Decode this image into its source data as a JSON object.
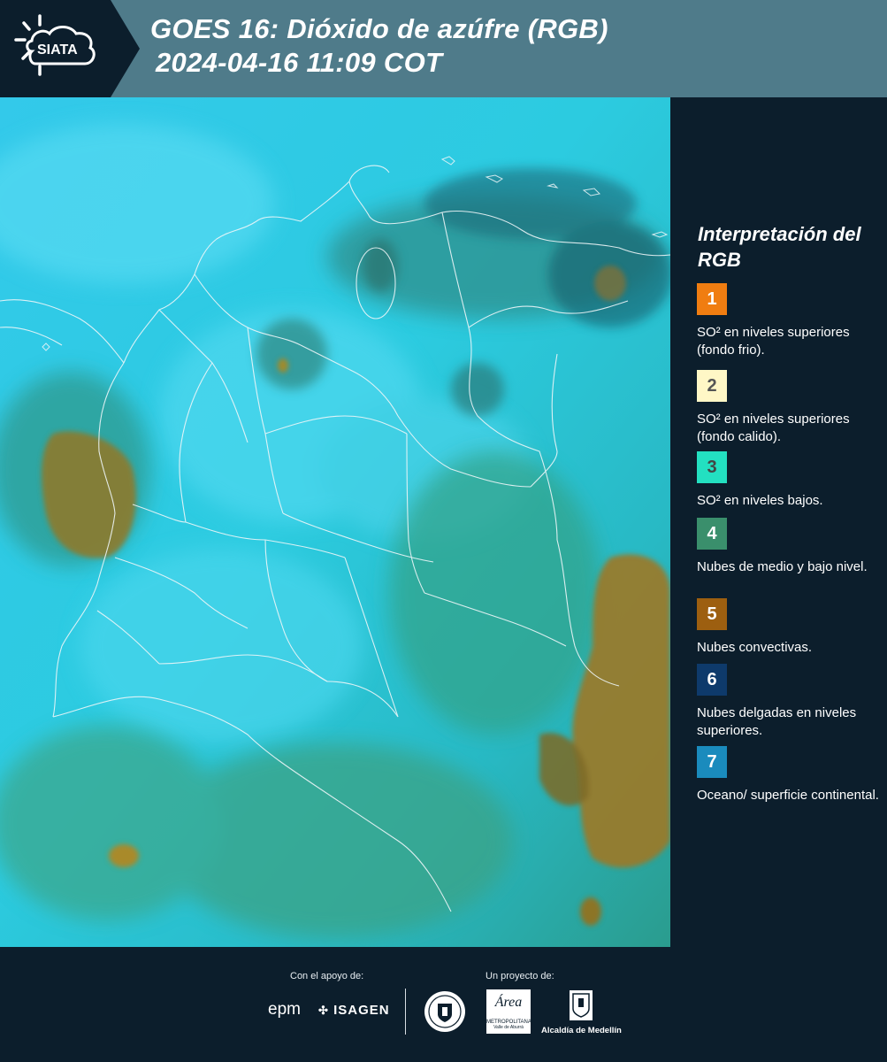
{
  "header": {
    "logo_text": "SIATA",
    "title_line1": "GOES 16: Dióxido de azúfre (RGB)",
    "title_line2": "2024-04-16 11:09 COT",
    "bg_color": "#4f7b8a"
  },
  "legend": {
    "title": "Interpretación del RGB",
    "items": [
      {
        "number": "1",
        "color": "#f07d11",
        "number_color": "#ffffff",
        "text": "SO² en niveles superiores (fondo frio)."
      },
      {
        "number": "2",
        "color": "#fff7c6",
        "number_color": "#555555",
        "text": "SO² en niveles superiores (fondo calido)."
      },
      {
        "number": "3",
        "color": "#23e0c1",
        "number_color": "#444444",
        "text": "SO² en niveles bajos."
      },
      {
        "number": "4",
        "color": "#3a8f6c",
        "number_color": "#ffffff",
        "text": "Nubes de medio y bajo nivel."
      },
      {
        "number": "5",
        "color": "#9d5f10",
        "number_color": "#ffffff",
        "text": "Nubes convectivas."
      },
      {
        "number": "6",
        "color": "#0e3a6b",
        "number_color": "#ffffff",
        "text": "Nubes delgadas en niveles superiores."
      },
      {
        "number": "7",
        "color": "#1a8bbd",
        "number_color": "#ffffff",
        "text": "Oceano/ superficie continental."
      }
    ]
  },
  "footer": {
    "support_label": "Con el apoyo de:",
    "project_label": "Un proyecto de:",
    "sponsor_epm": "epm",
    "sponsor_isagen": "ISAGEN",
    "area_text": "Área",
    "area_sub": "METROPOLITANA",
    "area_sub2": "Valle de Aburrá",
    "alcaldia": "Alcaldía de Medellín"
  }
}
